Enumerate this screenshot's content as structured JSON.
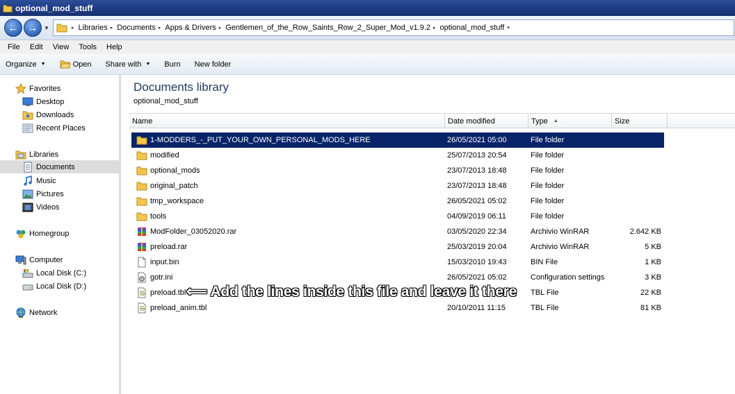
{
  "window": {
    "title": "optional_mod_stuff"
  },
  "address": {
    "crumbs": [
      "Libraries",
      "Documents",
      "Apps & Drivers",
      "Gentlemen_of_the_Row_Saints_Row_2_Super_Mod_v1.9.2",
      "optional_mod_stuff"
    ]
  },
  "menu": [
    "File",
    "Edit",
    "View",
    "Tools",
    "Help"
  ],
  "toolbar": {
    "organize": "Organize",
    "open": "Open",
    "share_with": "Share with",
    "burn": "Burn",
    "new_folder": "New folder"
  },
  "nav": {
    "favorites": "Favorites",
    "desktop": "Desktop",
    "downloads": "Downloads",
    "recent_places": "Recent Places",
    "libraries": "Libraries",
    "documents": "Documents",
    "music": "Music",
    "pictures": "Pictures",
    "videos": "Videos",
    "homegroup": "Homegroup",
    "computer": "Computer",
    "local_c": "Local Disk (C:)",
    "local_d": "Local Disk (D:)",
    "network": "Network"
  },
  "library": {
    "title": "Documents library",
    "subtitle": "optional_mod_stuff"
  },
  "columns": {
    "name": "Name",
    "date": "Date modified",
    "type": "Type",
    "size": "Size"
  },
  "files": [
    {
      "name": "1-MODDERS_-_PUT_YOUR_OWN_PERSONAL_MODS_HERE",
      "date": "26/05/2021 05:00",
      "type": "File folder",
      "size": "",
      "icon": "folder-icon"
    },
    {
      "name": "modified",
      "date": "25/07/2013 20:54",
      "type": "File folder",
      "size": "",
      "icon": "folder-icon"
    },
    {
      "name": "optional_mods",
      "date": "23/07/2013 18:48",
      "type": "File folder",
      "size": "",
      "icon": "folder-icon"
    },
    {
      "name": "original_patch",
      "date": "23/07/2013 18:48",
      "type": "File folder",
      "size": "",
      "icon": "folder-icon"
    },
    {
      "name": "tmp_workspace",
      "date": "26/05/2021 05:02",
      "type": "File folder",
      "size": "",
      "icon": "folder-icon"
    },
    {
      "name": "tools",
      "date": "04/09/2019 06:11",
      "type": "File folder",
      "size": "",
      "icon": "folder-icon"
    },
    {
      "name": "ModFolder_03052020.rar",
      "date": "03/05/2020 22:34",
      "type": "Archivio WinRAR",
      "size": "2.642 KB",
      "icon": "rar-icon"
    },
    {
      "name": "preload.rar",
      "date": "25/03/2019 20:04",
      "type": "Archivio WinRAR",
      "size": "5 KB",
      "icon": "rar-icon"
    },
    {
      "name": "input.bin",
      "date": "15/03/2010 19:43",
      "type": "BIN File",
      "size": "1 KB",
      "icon": "file-icon"
    },
    {
      "name": "gotr.ini",
      "date": "26/05/2021 05:02",
      "type": "Configuration settings",
      "size": "3 KB",
      "icon": "ini-icon"
    },
    {
      "name": "preload.tbl",
      "date": "",
      "type": "TBL File",
      "size": "22 KB",
      "icon": "tbl-icon"
    },
    {
      "name": "preload_anim.tbl",
      "date": "20/10/2011 11:15",
      "type": "TBL File",
      "size": "81 KB",
      "icon": "tbl-icon"
    }
  ],
  "annotation": "⟸ Add the lines inside this file and leave it there"
}
